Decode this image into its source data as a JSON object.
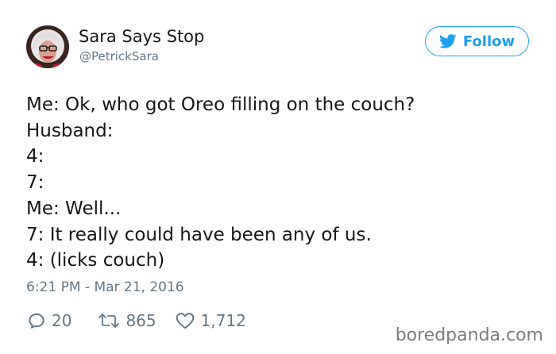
{
  "user": {
    "display_name": "Sara Says Stop",
    "handle": "@PetrickSara"
  },
  "follow_button": {
    "label": "Follow",
    "icon": "twitter-bird-icon"
  },
  "tweet": {
    "lines": [
      "Me: Ok, who got Oreo filling on the couch?",
      "Husband:",
      "4:",
      "7:",
      "Me: Well...",
      "7: It really could have been any of us.",
      "4: (licks couch)"
    ],
    "timestamp": "6:21 PM - Mar 21, 2016"
  },
  "actions": {
    "replies": "20",
    "retweets": "865",
    "likes": "1,712",
    "reply_icon": "reply-icon",
    "retweet_icon": "retweet-icon",
    "like_icon": "heart-icon"
  },
  "watermark": "boredpanda.com",
  "colors": {
    "accent": "#1da1f2",
    "text": "#14171a",
    "secondary": "#657786",
    "watermark": "#7d7d7d"
  }
}
